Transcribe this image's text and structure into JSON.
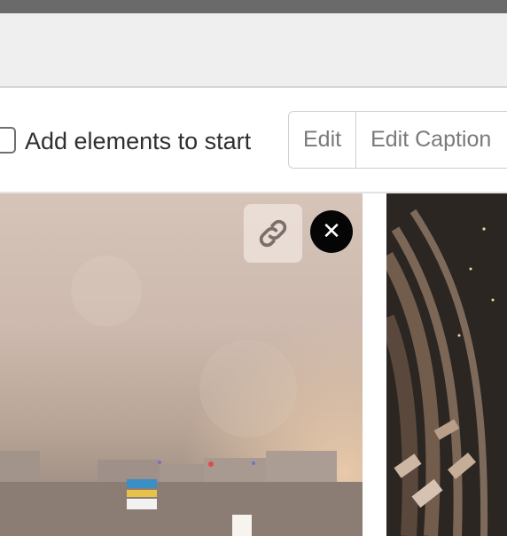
{
  "toolbar": {
    "label": "Add elements to start",
    "buttons": [
      {
        "label": "Edit"
      },
      {
        "label": "Edit Caption"
      }
    ]
  },
  "gallery": {
    "items": [
      {
        "actions": {
          "link_icon": "link-icon",
          "remove_icon": "close-icon",
          "remove_glyph": "✕"
        }
      },
      {}
    ]
  },
  "colors": {
    "topbar": "#6a6a6a",
    "header": "#efefef",
    "close_button": "#050505"
  }
}
